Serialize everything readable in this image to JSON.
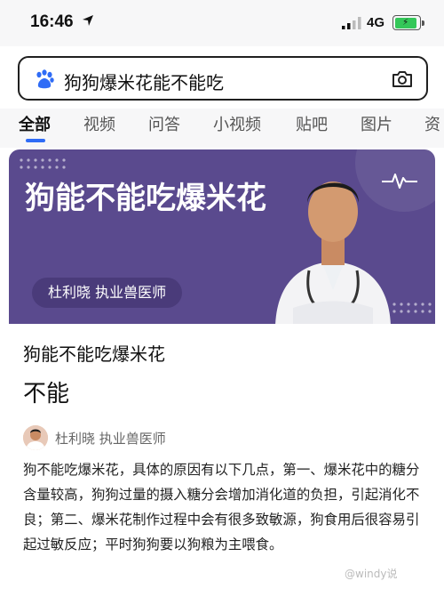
{
  "status_bar": {
    "time": "16:46",
    "network": "4G",
    "battery_level": 0.9
  },
  "search": {
    "query": "狗狗爆米花能不能吃",
    "accent_color": "#2f6cf6"
  },
  "tabs": [
    "全部",
    "视频",
    "问答",
    "小视频",
    "贴吧",
    "图片",
    "资"
  ],
  "banner": {
    "title": "狗能不能吃爆米花",
    "author": "杜利晓  执业兽医师",
    "background": "#5a4a8e"
  },
  "result": {
    "question": "狗能不能吃爆米花",
    "answer": "不能",
    "author": "杜利晓 执业兽医师",
    "body": "狗不能吃爆米花，具体的原因有以下几点，第一、爆米花中的糖分含量较高，狗狗过量的摄入糖分会增加消化道的负担，引起消化不良；第二、爆米花制作过程中会有很多致敏源，狗食用后很容易引起过敏反应；平时狗狗要以狗粮为主喂食。",
    "watermark": "@windy说"
  }
}
